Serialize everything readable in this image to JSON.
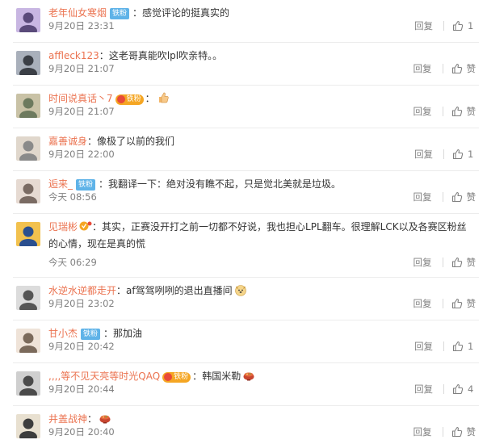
{
  "comments": [
    {
      "name": "老年仙女寒烟",
      "badge": "铁粉",
      "badge_type": "fan",
      "text": "感觉评论的挺真实的",
      "time": "9月20日 23:31",
      "reply": "回复",
      "likes": "1"
    },
    {
      "name": "affleck123",
      "badge": "",
      "badge_type": "",
      "text": "这老哥真能吹lpl吹亲特。。",
      "time": "9月20日 21:07",
      "reply": "回复",
      "likes": "赞"
    },
    {
      "name": "时间说真话丶7",
      "badge": "铁粉",
      "badge_type": "gold",
      "text": "",
      "emoji": "thumbs-up",
      "time": "9月20日 21:07",
      "reply": "回复",
      "likes": "赞"
    },
    {
      "name": "嘉善诚身",
      "badge": "",
      "badge_type": "",
      "text": "像极了以前的我们",
      "time": "9月20日 22:00",
      "reply": "回复",
      "likes": "1"
    },
    {
      "name": "逅来_",
      "badge": "铁粉",
      "badge_type": "fan",
      "text": "我翻译一下：绝对没有瞧不起，只是觉北美就是垃圾。",
      "time": "今天 08:56",
      "reply": "回复",
      "likes": "赞"
    },
    {
      "name": "见瑞彬",
      "badge": "",
      "badge_type": "v",
      "text": "其实，正赛没开打之前一切都不好说，我也担心LPL翻车。很理解LCK以及各赛区粉丝的心情，现在是真的慌",
      "time": "今天 06:29",
      "reply": "回复",
      "likes": "赞"
    },
    {
      "name": "水逆水逆都走开",
      "badge": "",
      "badge_type": "",
      "text": "af驾驾咧咧的退出直播间",
      "emoji": "doge",
      "time": "9月20日 23:02",
      "reply": "回复",
      "likes": "赞"
    },
    {
      "name": "甘小杰",
      "badge": "铁粉",
      "badge_type": "fan",
      "text": "那加油",
      "time": "9月20日 20:42",
      "reply": "回复",
      "likes": "1"
    },
    {
      "name": ",,,,等不见天亮等时光QAQ",
      "badge": "铁粉",
      "badge_type": "gold",
      "text": "韩国米勒",
      "emoji": "stew",
      "time": "9月20日 20:44",
      "reply": "回复",
      "likes": "4"
    },
    {
      "name": "井盖战神",
      "badge": "",
      "badge_type": "",
      "text": "",
      "emoji": "stew",
      "time": "9月20日 20:40",
      "reply": "回复",
      "likes": "赞"
    }
  ],
  "colors": {
    "username": "#eb7350",
    "time": "#808080",
    "fan_badge": "#5fb3e8",
    "gold_badge": "#f5a623"
  },
  "icons": {
    "like": "thumbs-up-outline-icon",
    "avatar": "user-avatar"
  }
}
